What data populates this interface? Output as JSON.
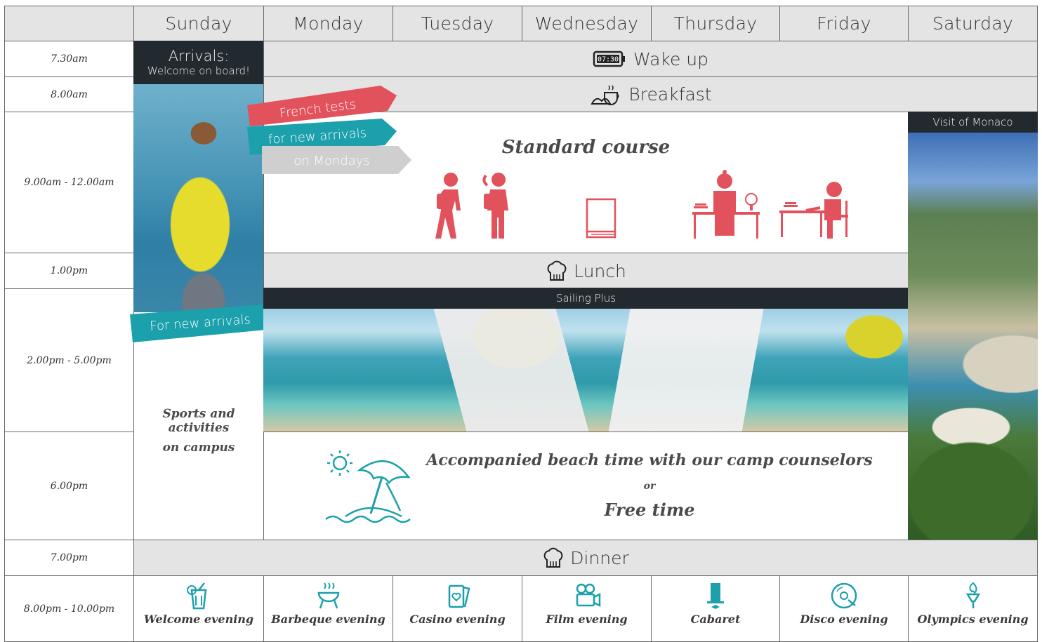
{
  "days": [
    "Sunday",
    "Monday",
    "Tuesday",
    "Wednesday",
    "Thursday",
    "Friday",
    "Saturday"
  ],
  "times": [
    "7.30am",
    "8.00am",
    "9.00am - 12.00am",
    "1.00pm",
    "2.00pm - 5.00pm",
    "6.00pm",
    "7.00pm",
    "8.00pm - 10.00pm"
  ],
  "sunday": {
    "arrivals_title": "Arrivals:",
    "arrivals_sub": "Welcome on board!",
    "sports": "Sports and activities",
    "sports_line2": "on campus",
    "ribbon_new_arrivals": "For new arrivals"
  },
  "bands": {
    "wake_up": "Wake up",
    "breakfast": "Breakfast",
    "lunch": "Lunch",
    "dinner": "Dinner"
  },
  "ribbons": {
    "french_tests": "French tests",
    "for_new_arrivals": "for new arrivals",
    "on_mondays": "on Mondays"
  },
  "morning": {
    "title": "Standard course"
  },
  "afternoon": {
    "sailing_label": "Sailing Plus"
  },
  "beach": {
    "line1": "Accompanied beach time with our camp counselors",
    "or": "or",
    "line2": "Free time"
  },
  "saturday": {
    "visit_label": "Visit of Monaco"
  },
  "evenings": [
    {
      "label": "Welcome evening",
      "icon": "cocktail-icon"
    },
    {
      "label": "Barbeque evening",
      "icon": "barbecue-icon"
    },
    {
      "label": "Casino evening",
      "icon": "playing-cards-icon"
    },
    {
      "label": "Film evening",
      "icon": "film-camera-icon"
    },
    {
      "label": "Cabaret",
      "icon": "top-hat-icon"
    },
    {
      "label": "Disco evening",
      "icon": "vinyl-record-icon"
    },
    {
      "label": "Olympics evening",
      "icon": "olympic-torch-icon"
    }
  ],
  "colors": {
    "header_gray": "#e4e4e4",
    "red": "#e2525c",
    "teal": "#1ba0ac",
    "gray_ribbon": "#cfcfcf",
    "dark_bar": "#222a30"
  }
}
